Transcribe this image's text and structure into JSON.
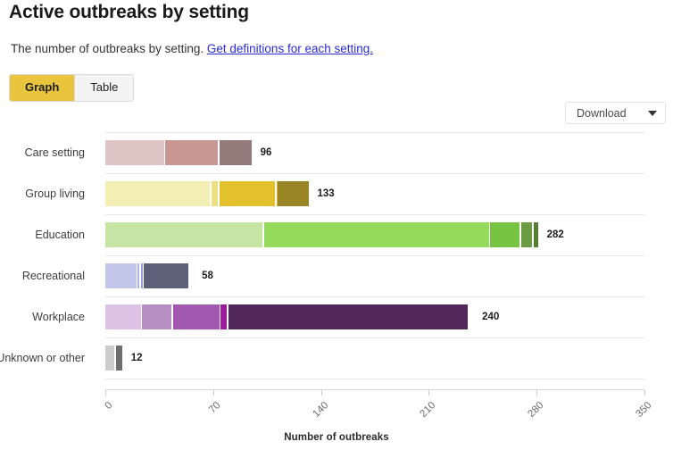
{
  "header": {
    "title": "Active outbreaks by setting",
    "description": "The number of outbreaks by setting.",
    "link_text": "Get definitions for each setting."
  },
  "view_tabs": [
    {
      "label": "Graph",
      "active": true
    },
    {
      "label": "Table",
      "active": false
    }
  ],
  "download": {
    "label": "Download",
    "icon": "chevron-down-icon"
  },
  "chart_data": {
    "type": "bar",
    "orientation": "horizontal",
    "stacked": true,
    "title": "Active outbreaks by setting",
    "xlabel": "Number of outbreaks",
    "ylabel": "",
    "xlim": [
      0,
      350
    ],
    "xticks": [
      0,
      70,
      140,
      210,
      280,
      350
    ],
    "xtick_labels": [
      "0",
      "70",
      "140",
      "210",
      "280",
      "350"
    ],
    "grid": false,
    "legend": "none",
    "categories": [
      "Care setting",
      "Group living",
      "Education",
      "Recreational",
      "Workplace",
      "Unknown or other"
    ],
    "totals": [
      96,
      133,
      282,
      58,
      240,
      12
    ],
    "total_labels": [
      "96",
      "133",
      "282",
      "58",
      "240",
      "12"
    ],
    "rows": [
      {
        "category": "Care setting",
        "total": 96,
        "total_label": "96",
        "segments": [
          {
            "value": 39,
            "color": "#dfc5c3"
          },
          {
            "value": 35,
            "color": "#c89792"
          },
          {
            "value": 22,
            "color": "#947a78"
          }
        ]
      },
      {
        "category": "Group living",
        "total": 133,
        "total_label": "133",
        "segments": [
          {
            "value": 69,
            "color": "#f2eeb4"
          },
          {
            "value": 5,
            "color": "#ebe083"
          },
          {
            "value": 37,
            "color": "#e2c12c"
          },
          {
            "value": 1,
            "color": "#d9bb2c"
          },
          {
            "value": 21,
            "color": "#9a8526"
          }
        ]
      },
      {
        "category": "Education",
        "total": 282,
        "total_label": "282",
        "segments": [
          {
            "value": 103,
            "color": "#c6e5a4"
          },
          {
            "value": 147,
            "color": "#96da5c"
          },
          {
            "value": 20,
            "color": "#76c442"
          },
          {
            "value": 8,
            "color": "#6a9c43"
          },
          {
            "value": 4,
            "color": "#53802f"
          }
        ]
      },
      {
        "category": "Recreational",
        "total": 58,
        "total_label": "58",
        "segments": [
          {
            "value": 21,
            "color": "#c2c6e8"
          },
          {
            "value": 2,
            "color": "#aeb4e0"
          },
          {
            "value": 2,
            "color": "#9aa0d6"
          },
          {
            "value": 30,
            "color": "#5c6078"
          }
        ]
      },
      {
        "category": "Workplace",
        "total": 240,
        "total_label": "240",
        "segments": [
          {
            "value": 24,
            "color": "#dcc2e4"
          },
          {
            "value": 20,
            "color": "#b78ec4"
          },
          {
            "value": 31,
            "color": "#a258ae"
          },
          {
            "value": 5,
            "color": "#9c1b9c"
          },
          {
            "value": 156,
            "color": "#52275a"
          }
        ]
      },
      {
        "category": "Unknown or other",
        "total": 12,
        "total_label": "12",
        "segments": [
          {
            "value": 7,
            "color": "#cccccc"
          },
          {
            "value": 5,
            "color": "#6e6e6e"
          }
        ]
      }
    ]
  }
}
